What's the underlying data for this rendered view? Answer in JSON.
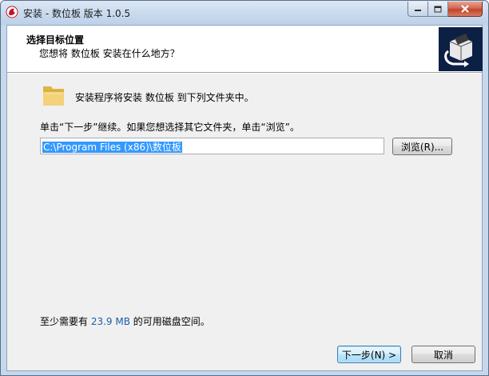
{
  "window": {
    "title": "安装 - 数位板 版本 1.0.5"
  },
  "header": {
    "title": "选择目标位置",
    "subtitle": "您想将 数位板 安装在什么地方？"
  },
  "body": {
    "intro": "安装程序将安装 数位板 到下列文件夹中。",
    "continue_hint": "单击“下一步”继续。如果您想选择其它文件夹，单击“浏览”。",
    "path_value": "C:\\Program Files (x86)\\数位板",
    "browse_label": "浏览(R)...",
    "space_prefix": "至少需要有 ",
    "space_size": "23.9 MB",
    "space_suffix": " 的可用磁盘空间。"
  },
  "footer": {
    "next_label": "下一步(N) >",
    "cancel_label": "取消"
  },
  "colors": {
    "selection": "#3399ff",
    "wizard_image_bg": "#0c1f45",
    "default_button_border": "#3c7fb1"
  },
  "icons": [
    "app-icon",
    "minimize-icon",
    "maximize-icon",
    "close-icon",
    "wizard-image-icon",
    "folder-icon"
  ]
}
